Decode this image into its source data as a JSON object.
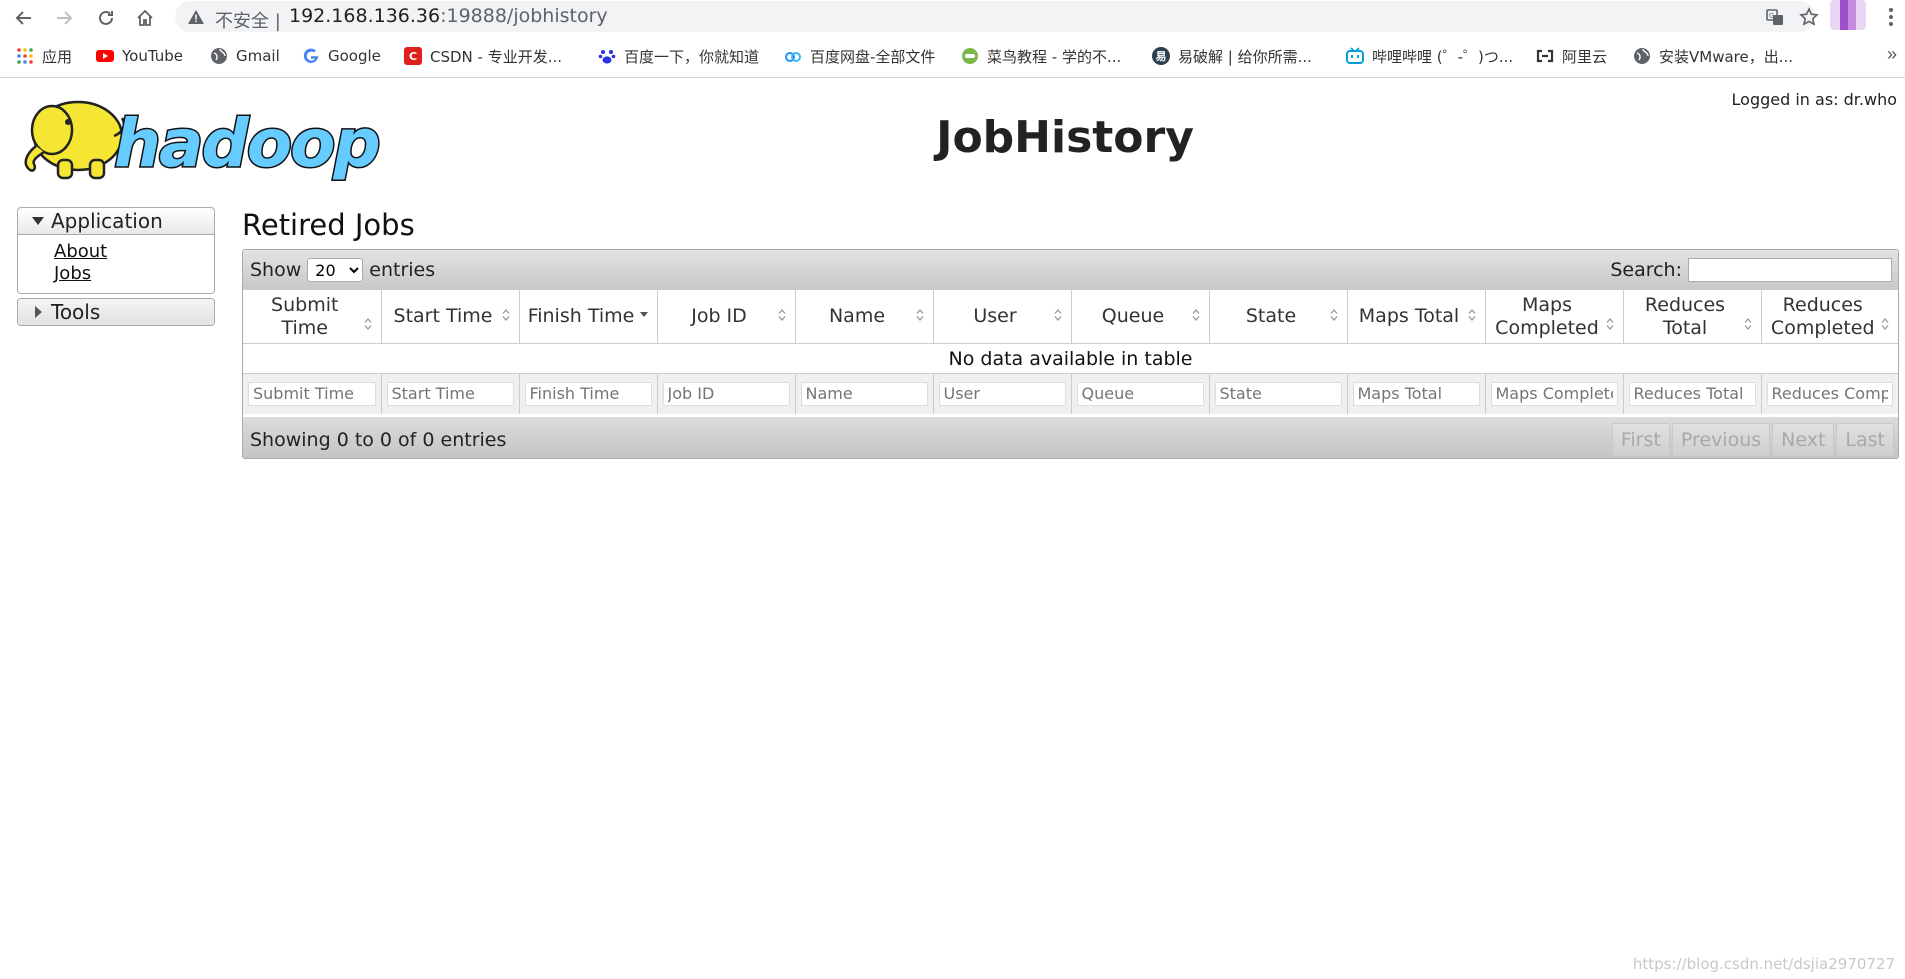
{
  "browser": {
    "security_label": "不安全 |",
    "url_host": "192.168.136.36",
    "url_rest": ":19888/jobhistory",
    "bookmarks": [
      {
        "label": "应用",
        "icon": "apps-grid-icon"
      },
      {
        "label": "YouTube",
        "icon": "youtube-icon"
      },
      {
        "label": "Gmail",
        "icon": "globe-icon"
      },
      {
        "label": "Google",
        "icon": "google-icon"
      },
      {
        "label": "CSDN - 专业开发...",
        "icon": "csdn-icon"
      },
      {
        "label": "百度一下，你就知道",
        "icon": "baidu-paw-icon"
      },
      {
        "label": "百度网盘-全部文件",
        "icon": "baidu-pan-icon"
      },
      {
        "label": "菜鸟教程 - 学的不...",
        "icon": "runoob-icon"
      },
      {
        "label": "易破解 | 给你所需...",
        "icon": "ypojie-icon"
      },
      {
        "label": "哔哩哔哩 (゜-゜)つ...",
        "icon": "bilibili-icon"
      },
      {
        "label": "阿里云",
        "icon": "aliyun-icon"
      },
      {
        "label": "安装VMware，出...",
        "icon": "globe-icon"
      }
    ],
    "more_label": "»"
  },
  "header": {
    "logo_text": "hadoop",
    "title": "JobHistory",
    "logged_in": "Logged in as: dr.who"
  },
  "sidebar": {
    "application": {
      "label": "Application",
      "links": [
        "About",
        "Jobs"
      ]
    },
    "tools": {
      "label": "Tools"
    }
  },
  "main": {
    "title": "Retired Jobs",
    "length": {
      "prefix": "Show",
      "selected": "20",
      "suffix": "entries"
    },
    "search_label": "Search:",
    "columns": [
      "Submit Time",
      "Start Time",
      "Finish Time",
      "Job ID",
      "Name",
      "User",
      "Queue",
      "State",
      "Maps Total",
      "Maps Completed",
      "Reduces Total",
      "Reduces Completed"
    ],
    "filter_placeholders": [
      "Submit Time",
      "Start Time",
      "Finish Time",
      "Job ID",
      "Name",
      "User",
      "Queue",
      "State",
      "Maps Total",
      "Maps Completed",
      "Reduces Total",
      "Reduces Completed"
    ],
    "empty_text": "No data available in table",
    "info": "Showing 0 to 0 of 0 entries",
    "pagination": [
      "First",
      "Previous",
      "Next",
      "Last"
    ]
  },
  "watermark": "https://blog.csdn.net/dsjia2970727",
  "colors": {
    "youtube": "#ff0000",
    "csdn": "#e0201f",
    "baidu": "#2932e1",
    "bilibili": "#00a1d6",
    "logo_yellow": "#f5e633",
    "logo_blue": "#66ccff"
  }
}
